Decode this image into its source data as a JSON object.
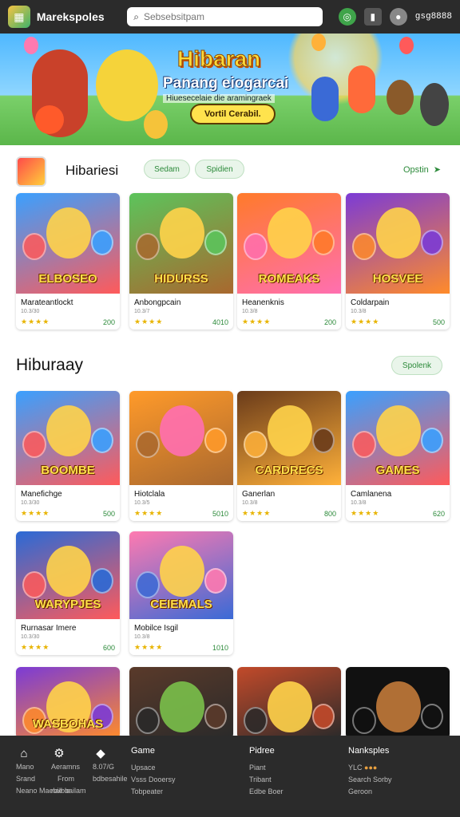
{
  "header": {
    "brand": "Marekspoles",
    "search_placeholder": "Sebsebsitpam",
    "username": "gsg8888",
    "icons": [
      "app-logo-icon",
      "search-icon",
      "notification-icon",
      "chart-icon",
      "user-avatar-icon"
    ]
  },
  "hero": {
    "title": "Hibaran",
    "subtitle": "Panang eiogarcai",
    "tagline": "Hiuesecelaie die aramingraek",
    "button": "Vortil Cerabil."
  },
  "section1": {
    "title": "Hibariesi",
    "pill1": "Sedam",
    "pill2": "Spidien",
    "more": "Opstin",
    "cards": [
      {
        "thumb_text": "ELBOSEO",
        "name": "Marateantlockt",
        "sub": "10.3/30",
        "stars": "★★★★",
        "value": "200",
        "colors": [
          "#3aa0ff",
          "#ff5a5a",
          "#ffd34a"
        ]
      },
      {
        "thumb_text": "HIDURSS",
        "name": "Anbongpcain",
        "sub": "10.3/7",
        "stars": "★★★★",
        "value": "4010",
        "colors": [
          "#5cc45c",
          "#a9682e",
          "#ffd34a"
        ]
      },
      {
        "thumb_text": "ROMEAKS",
        "name": "Heanenknis",
        "sub": "10.3/8",
        "stars": "★★★★",
        "value": "200",
        "colors": [
          "#ff7a2a",
          "#ff6fb0",
          "#ffd34a"
        ]
      },
      {
        "thumb_text": "HOSVEE",
        "name": "Coldarpain",
        "sub": "10.3/8",
        "stars": "★★★★",
        "value": "500",
        "colors": [
          "#7b3bd6",
          "#ff8b2a",
          "#ffd34a"
        ]
      }
    ]
  },
  "section2": {
    "title": "Hiburaay",
    "pill": "Spolenk",
    "cards": [
      {
        "thumb_text": "BOOMBE",
        "name": "Manefichge",
        "sub": "10.3/30",
        "stars": "★★★★",
        "value": "500",
        "colors": [
          "#3aa0ff",
          "#ff5a5a",
          "#ffd34a"
        ]
      },
      {
        "thumb_text": "",
        "name": "Hiotclala",
        "sub": "10.3/5",
        "stars": "★★★★",
        "value": "5010",
        "colors": [
          "#ff9a2a",
          "#a9682e",
          "#ff6fb0"
        ]
      },
      {
        "thumb_text": "CARDRECS",
        "name": "Ganerlan",
        "sub": "10.3/8",
        "stars": "★★★★",
        "value": "800",
        "colors": [
          "#6a3b1a",
          "#ffb13a",
          "#ffd34a"
        ]
      },
      {
        "thumb_text": "GAMES",
        "name": "Camlanena",
        "sub": "10.3/8",
        "stars": "★★★★",
        "value": "620",
        "colors": [
          "#3aa0ff",
          "#ff5a5a",
          "#ffd34a"
        ]
      },
      {
        "thumb_text": "WARYPJES",
        "name": "Rurnasar Imere",
        "sub": "10.3/30",
        "stars": "★★★★",
        "value": "600",
        "colors": [
          "#2a6ad6",
          "#ff5a5a",
          "#ffd34a"
        ]
      },
      {
        "thumb_text": "CEIEMALS",
        "name": "Mobilce Isgil",
        "sub": "10.3/8",
        "stars": "★★★★",
        "value": "1010",
        "colors": [
          "#ff7ab0",
          "#3a6ad6",
          "#ffd34a"
        ]
      }
    ],
    "bottom_cards": [
      {
        "thumb_text": "WASBOHAS",
        "colors": [
          "#7b3bd6",
          "#ff8b2a",
          "#ffd34a"
        ]
      },
      {
        "thumb_text": "",
        "colors": [
          "#5a3a2a",
          "#2a2a2a",
          "#7ac04a"
        ]
      },
      {
        "thumb_text": "",
        "colors": [
          "#c24a2a",
          "#2a2a2a",
          "#ffd34a"
        ]
      },
      {
        "thumb_text": "",
        "colors": [
          "#111111",
          "#111111",
          "#c27a3a"
        ]
      }
    ]
  },
  "footer": {
    "col1": [
      "Mano",
      "Srand",
      "Neano Maebie oailam"
    ],
    "col2": [
      "Aeramns",
      "From",
      "nalble"
    ],
    "col3": [
      "8.07/G",
      "",
      "bdbesahile"
    ],
    "col4_head": "Game",
    "col4": [
      "Upsace",
      "Vsss Dooersy",
      "Tobpeater"
    ],
    "col5_head": "Pidree",
    "col5": [
      "Piant",
      "Tribant",
      "Edbe Boer"
    ],
    "col6_head": "Nanksples",
    "col6": [
      "YLC",
      "Search Sorby",
      "Geroon"
    ]
  }
}
